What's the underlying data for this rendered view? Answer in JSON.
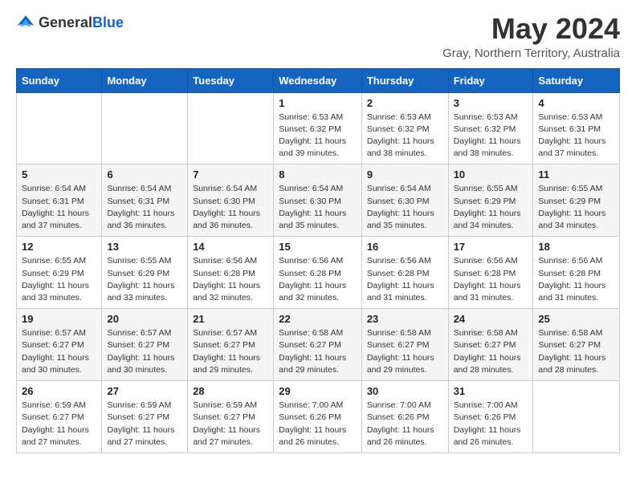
{
  "logo": {
    "general": "General",
    "blue": "Blue"
  },
  "title": "May 2024",
  "subtitle": "Gray, Northern Territory, Australia",
  "days_of_week": [
    "Sunday",
    "Monday",
    "Tuesday",
    "Wednesday",
    "Thursday",
    "Friday",
    "Saturday"
  ],
  "weeks": [
    [
      {
        "day": "",
        "info": ""
      },
      {
        "day": "",
        "info": ""
      },
      {
        "day": "",
        "info": ""
      },
      {
        "day": "1",
        "info": "Sunrise: 6:53 AM\nSunset: 6:32 PM\nDaylight: 11 hours\nand 39 minutes."
      },
      {
        "day": "2",
        "info": "Sunrise: 6:53 AM\nSunset: 6:32 PM\nDaylight: 11 hours\nand 38 minutes."
      },
      {
        "day": "3",
        "info": "Sunrise: 6:53 AM\nSunset: 6:32 PM\nDaylight: 11 hours\nand 38 minutes."
      },
      {
        "day": "4",
        "info": "Sunrise: 6:53 AM\nSunset: 6:31 PM\nDaylight: 11 hours\nand 37 minutes."
      }
    ],
    [
      {
        "day": "5",
        "info": "Sunrise: 6:54 AM\nSunset: 6:31 PM\nDaylight: 11 hours\nand 37 minutes."
      },
      {
        "day": "6",
        "info": "Sunrise: 6:54 AM\nSunset: 6:31 PM\nDaylight: 11 hours\nand 36 minutes."
      },
      {
        "day": "7",
        "info": "Sunrise: 6:54 AM\nSunset: 6:30 PM\nDaylight: 11 hours\nand 36 minutes."
      },
      {
        "day": "8",
        "info": "Sunrise: 6:54 AM\nSunset: 6:30 PM\nDaylight: 11 hours\nand 35 minutes."
      },
      {
        "day": "9",
        "info": "Sunrise: 6:54 AM\nSunset: 6:30 PM\nDaylight: 11 hours\nand 35 minutes."
      },
      {
        "day": "10",
        "info": "Sunrise: 6:55 AM\nSunset: 6:29 PM\nDaylight: 11 hours\nand 34 minutes."
      },
      {
        "day": "11",
        "info": "Sunrise: 6:55 AM\nSunset: 6:29 PM\nDaylight: 11 hours\nand 34 minutes."
      }
    ],
    [
      {
        "day": "12",
        "info": "Sunrise: 6:55 AM\nSunset: 6:29 PM\nDaylight: 11 hours\nand 33 minutes."
      },
      {
        "day": "13",
        "info": "Sunrise: 6:55 AM\nSunset: 6:29 PM\nDaylight: 11 hours\nand 33 minutes."
      },
      {
        "day": "14",
        "info": "Sunrise: 6:56 AM\nSunset: 6:28 PM\nDaylight: 11 hours\nand 32 minutes."
      },
      {
        "day": "15",
        "info": "Sunrise: 6:56 AM\nSunset: 6:28 PM\nDaylight: 11 hours\nand 32 minutes."
      },
      {
        "day": "16",
        "info": "Sunrise: 6:56 AM\nSunset: 6:28 PM\nDaylight: 11 hours\nand 31 minutes."
      },
      {
        "day": "17",
        "info": "Sunrise: 6:56 AM\nSunset: 6:28 PM\nDaylight: 11 hours\nand 31 minutes."
      },
      {
        "day": "18",
        "info": "Sunrise: 6:56 AM\nSunset: 6:28 PM\nDaylight: 11 hours\nand 31 minutes."
      }
    ],
    [
      {
        "day": "19",
        "info": "Sunrise: 6:57 AM\nSunset: 6:27 PM\nDaylight: 11 hours\nand 30 minutes."
      },
      {
        "day": "20",
        "info": "Sunrise: 6:57 AM\nSunset: 6:27 PM\nDaylight: 11 hours\nand 30 minutes."
      },
      {
        "day": "21",
        "info": "Sunrise: 6:57 AM\nSunset: 6:27 PM\nDaylight: 11 hours\nand 29 minutes."
      },
      {
        "day": "22",
        "info": "Sunrise: 6:58 AM\nSunset: 6:27 PM\nDaylight: 11 hours\nand 29 minutes."
      },
      {
        "day": "23",
        "info": "Sunrise: 6:58 AM\nSunset: 6:27 PM\nDaylight: 11 hours\nand 29 minutes."
      },
      {
        "day": "24",
        "info": "Sunrise: 6:58 AM\nSunset: 6:27 PM\nDaylight: 11 hours\nand 28 minutes."
      },
      {
        "day": "25",
        "info": "Sunrise: 6:58 AM\nSunset: 6:27 PM\nDaylight: 11 hours\nand 28 minutes."
      }
    ],
    [
      {
        "day": "26",
        "info": "Sunrise: 6:59 AM\nSunset: 6:27 PM\nDaylight: 11 hours\nand 27 minutes."
      },
      {
        "day": "27",
        "info": "Sunrise: 6:59 AM\nSunset: 6:27 PM\nDaylight: 11 hours\nand 27 minutes."
      },
      {
        "day": "28",
        "info": "Sunrise: 6:59 AM\nSunset: 6:27 PM\nDaylight: 11 hours\nand 27 minutes."
      },
      {
        "day": "29",
        "info": "Sunrise: 7:00 AM\nSunset: 6:26 PM\nDaylight: 11 hours\nand 26 minutes."
      },
      {
        "day": "30",
        "info": "Sunrise: 7:00 AM\nSunset: 6:26 PM\nDaylight: 11 hours\nand 26 minutes."
      },
      {
        "day": "31",
        "info": "Sunrise: 7:00 AM\nSunset: 6:26 PM\nDaylight: 11 hours\nand 26 minutes."
      },
      {
        "day": "",
        "info": ""
      }
    ]
  ]
}
